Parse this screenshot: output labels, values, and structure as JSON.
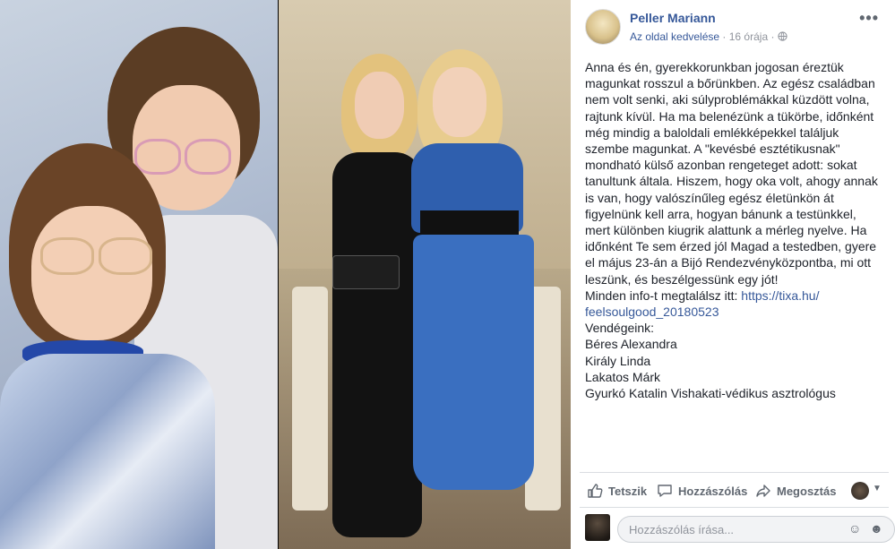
{
  "post": {
    "author": "Peller Mariann",
    "like_page": "Az oldal kedvelése",
    "separator": "·",
    "time": "16 órája",
    "more_label": "•••",
    "body_lines": [
      "Anna és én, gyerekkorunkban jogosan éreztük",
      "magunkat rosszul a bőrünkben. Az egész családban",
      "nem volt senki, aki súlyproblémákkal küzdött volna,",
      "rajtunk kívül. Ha ma belenézünk a tükörbe, időnként",
      "még mindig a baloldali emlékképekkel találjuk",
      "szembe magunkat. A \"kevésbé esztétikusnak\"",
      "mondható külső azonban rengeteget adott: sokat",
      "tanultunk általa. Hiszem, hogy oka volt, ahogy annak",
      "is van, hogy valószínűleg egész életünkön át",
      "figyelnünk kell arra, hogyan bánunk a testünkkel,",
      "mert különben kiugrik alattunk a mérleg nyelve. Ha",
      "időnként Te sem érzed jól Magad a testedben, gyere",
      "el május 23-án a Bijó Rendezvényközpontba, mi ott",
      "leszünk, és beszélgessünk egy jót!"
    ],
    "info_prefix": "Minden info-t megtalálsz itt: ",
    "link_part1": "https://tixa.hu/",
    "link_part2": "feelsoulgood_20180523",
    "guests_title": "Vendégeink:",
    "guests": [
      "Béres Alexandra",
      "Király Linda",
      "Lakatos Márk",
      "Gyurkó Katalin Vishakati-védikus asztrológus"
    ]
  },
  "actions": {
    "like": "Tetszik",
    "comment": "Hozzászólás",
    "share": "Megosztás"
  },
  "comment_box": {
    "placeholder": "Hozzászólás írása..."
  },
  "colors": {
    "link": "#365899",
    "text": "#1d2129",
    "muted": "#90949c"
  },
  "icons": [
    "globe-icon",
    "like-icon",
    "comment-icon",
    "share-icon",
    "emoji-icon",
    "sticker-icon",
    "caret-down-icon"
  ]
}
